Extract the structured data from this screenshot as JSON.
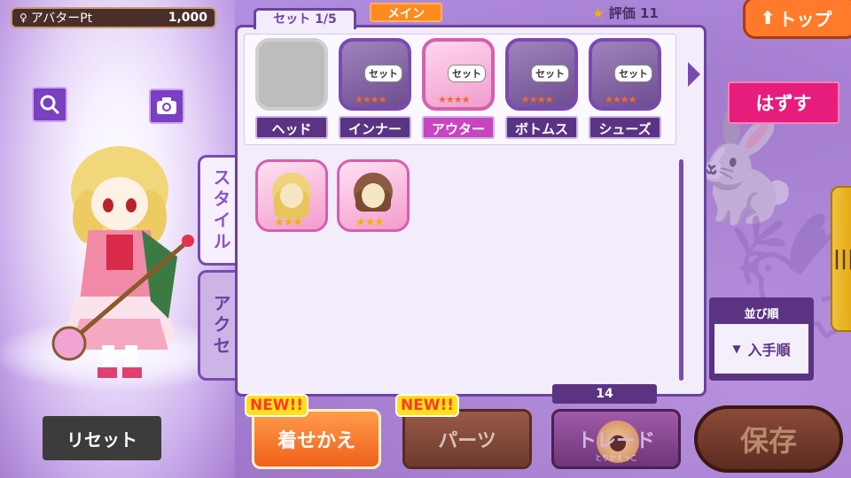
{
  "header": {
    "avatar_pt_label": "アバターPt",
    "avatar_pt_value": "1,000",
    "set_tab": "セット 1/5",
    "main_tag": "メイン",
    "rating_label": "評価",
    "rating_value": "11",
    "top_button": "トップ"
  },
  "stage": {
    "reset_button": "リセット"
  },
  "side_tabs": [
    {
      "label": "スタイル",
      "active": true
    },
    {
      "label": "アクセ",
      "active": false
    }
  ],
  "slots": [
    {
      "label": "ヘッド",
      "state": "empty",
      "badge": "",
      "stars": ""
    },
    {
      "label": "インナー",
      "state": "locked",
      "badge": "セット",
      "stars": "★★★★"
    },
    {
      "label": "アウター",
      "state": "active",
      "badge": "セット",
      "stars": "★★★★"
    },
    {
      "label": "ボトムス",
      "state": "locked",
      "badge": "セット",
      "stars": "★★★★"
    },
    {
      "label": "シューズ",
      "state": "locked",
      "badge": "セット",
      "stars": "★★★★"
    }
  ],
  "items": [
    {
      "name": "blonde-wavy-hair",
      "stars": "★★★"
    },
    {
      "name": "brown-short-hair",
      "stars": "★★★"
    }
  ],
  "right": {
    "remove_button": "はずす",
    "sort_title": "並び順",
    "sort_value": "入手順"
  },
  "bottom": {
    "count": "14",
    "new_badge": "NEW!!",
    "dress_button": "着せかえ",
    "parts_button": "パーツ",
    "trade_button": "トレード",
    "trade_sub": "とりかえっこ",
    "save_button": "保存"
  },
  "colors": {
    "accent": "#7a4ab0",
    "highlight": "#e61d7a",
    "orange": "#ff7a2a"
  }
}
